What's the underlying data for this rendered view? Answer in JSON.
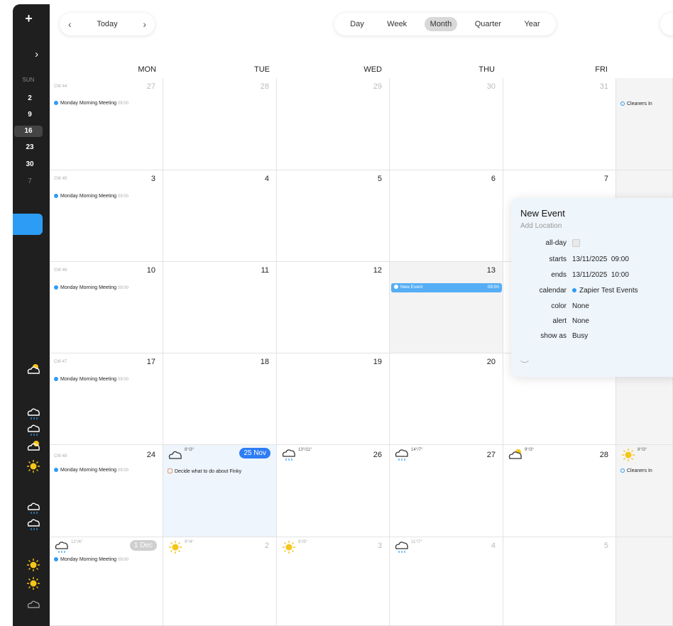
{
  "toolbar": {
    "today_label": "Today",
    "prev": "‹",
    "next": "›",
    "views": [
      "Day",
      "Week",
      "Month",
      "Quarter",
      "Year"
    ],
    "active_view": "Month"
  },
  "sidebar": {
    "plus": "+",
    "arrows": "‹ ›",
    "weekday": "SUN",
    "dates": [
      "2",
      "9",
      "16",
      "23",
      "30",
      "7"
    ],
    "selected": "16"
  },
  "days": [
    "MON",
    "TUE",
    "WED",
    "THU",
    "FRI"
  ],
  "weeks": [
    {
      "cw": "CW 44",
      "dates": [
        "27",
        "28",
        "29",
        "30",
        "31"
      ]
    },
    {
      "cw": "CW 45",
      "dates": [
        "3",
        "4",
        "5",
        "6",
        "7"
      ]
    },
    {
      "cw": "CW 46",
      "dates": [
        "10",
        "11",
        "12",
        "13",
        ""
      ]
    },
    {
      "cw": "CW 47",
      "dates": [
        "17",
        "18",
        "19",
        "20",
        ""
      ]
    },
    {
      "cw": "CW 48",
      "dates": [
        "24",
        "25 Nov",
        "26",
        "27",
        "28"
      ]
    },
    {
      "cw": "",
      "dates": [
        "1 Dec",
        "2",
        "3",
        "4",
        "5"
      ]
    }
  ],
  "events": {
    "monday": "Monday Morning Meeting",
    "monday_time": "09:00",
    "cleaners": "Cleaners In",
    "new_event": "New Event",
    "new_event_time": "09:00",
    "task": "Decide what to do about Finky"
  },
  "weather": {
    "tue25": "8°/3°",
    "wed26": "13°/11°",
    "thu27": "14°/7°",
    "fri28": "9°/3°",
    "sat29": "8°/3°",
    "mon1": "12°/6°",
    "tue2": "9°/4°",
    "wed3": "8°/5°",
    "thu4": "11°/7°"
  },
  "popover": {
    "title": "New Event",
    "location": "Add Location",
    "allday_label": "all-day",
    "starts_label": "starts",
    "starts_date": "13/11/2025",
    "starts_time": "09:00",
    "ends_label": "ends",
    "ends_date": "13/11/2025",
    "ends_time": "10:00",
    "calendar_label": "calendar",
    "calendar_value": "Zapier Test Events",
    "color_label": "color",
    "color_value": "None",
    "alert_label": "alert",
    "alert_value": "None",
    "showas_label": "show as",
    "showas_value": "Busy"
  },
  "colors": {
    "accent": "#2d9cf5",
    "today_pill": "#2d7df5",
    "sidebar": "#1f1f1f"
  }
}
